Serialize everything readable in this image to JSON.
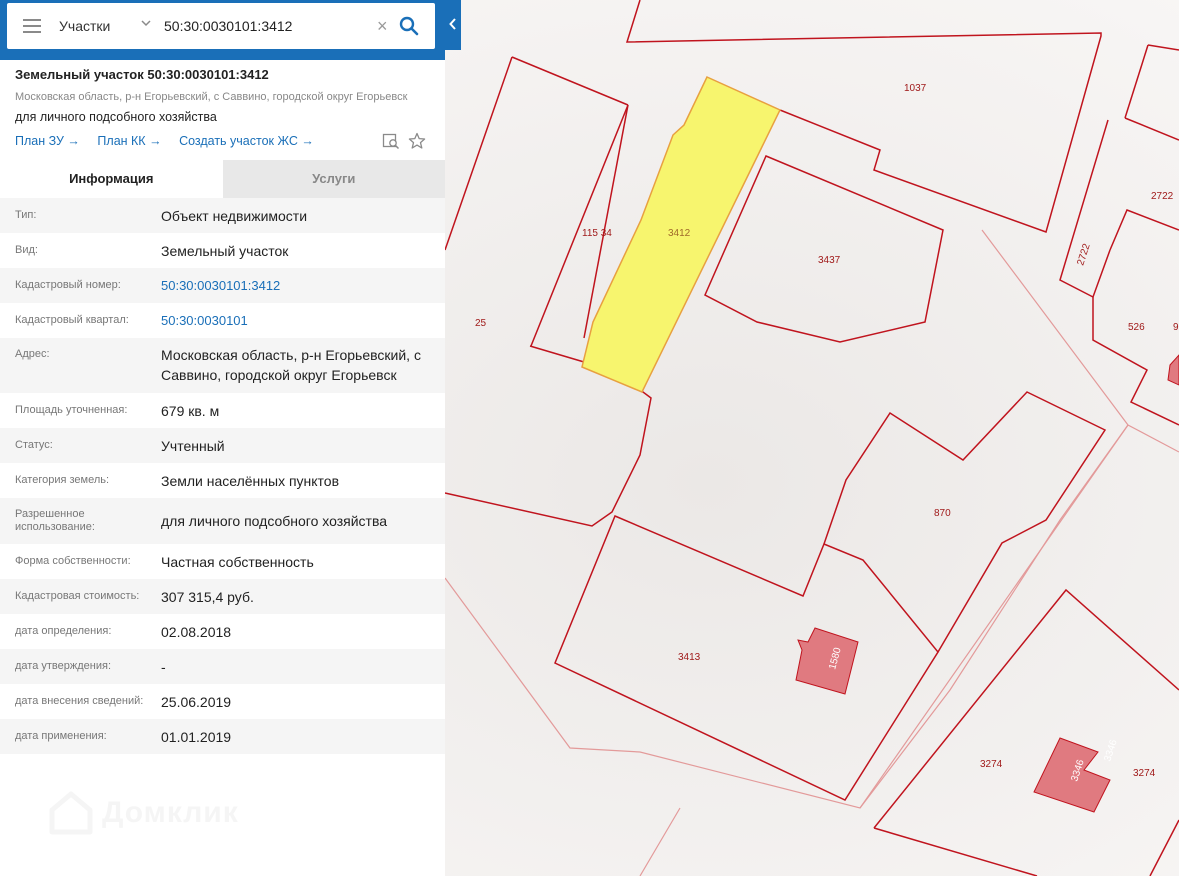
{
  "search": {
    "layer": "Участки",
    "query": "50:30:0030101:3412"
  },
  "parcel": {
    "title": "Земельный участок 50:30:0030101:3412",
    "address": "Московская область, р-н Егорьевский, с Саввино, городской округ Егорьевск",
    "purpose": "для личного подсобного хозяйства",
    "links": [
      "План ЗУ →",
      "План КК →",
      "Создать участок ЖС →"
    ]
  },
  "tabs": [
    "Информация",
    "Услуги"
  ],
  "info": [
    {
      "key": "Тип:",
      "value": "Объект недвижимости"
    },
    {
      "key": "Вид:",
      "value": "Земельный участок"
    },
    {
      "key": "Кадастровый номер:",
      "value": "50:30:0030101:3412"
    },
    {
      "key": "Кадастровый квартал:",
      "value": "50:30:0030101"
    },
    {
      "key": "Адрес:",
      "value": "Московская область, р-н Егорьевский, с Саввино, городской округ Егорьевск"
    },
    {
      "key": "Площадь уточненная:",
      "value": "679 кв. м"
    },
    {
      "key": "Статус:",
      "value": "Учтенный"
    },
    {
      "key": "Категория земель:",
      "value": "Земли населённых пунктов"
    },
    {
      "key": "Разрешенное использование:",
      "value": "для личного подсобного хозяйства"
    },
    {
      "key": "Форма собственности:",
      "value": "Частная собственность"
    },
    {
      "key": "Кадастровая стоимость:",
      "value": "307 315,4 руб."
    },
    {
      "key": "дата определения:",
      "value": "02.08.2018"
    },
    {
      "key": "дата утверждения:",
      "value": "-"
    },
    {
      "key": "дата внесения сведений:",
      "value": "25.06.2019"
    },
    {
      "key": "дата применения:",
      "value": "01.01.2019"
    }
  ],
  "watermark": "Домклик",
  "map_labels": {
    "p1037": "1037",
    "p3412": "3412",
    "p11534": "115 34",
    "p3437": "3437",
    "p25": "25",
    "p2722a": "2722",
    "p2722b": "2722",
    "p526": "526",
    "p9": "9",
    "p870": "870",
    "p3413": "3413",
    "p1580": "1580",
    "p3274a": "3274",
    "p3274b": "3274",
    "p3346a": "3346",
    "p3346b": "3346"
  },
  "colors": {
    "accent": "#1a6fb8",
    "parcel_border": "#c0141e",
    "selected_fill": "#f7f56e",
    "building_fill": "#e07a80"
  }
}
